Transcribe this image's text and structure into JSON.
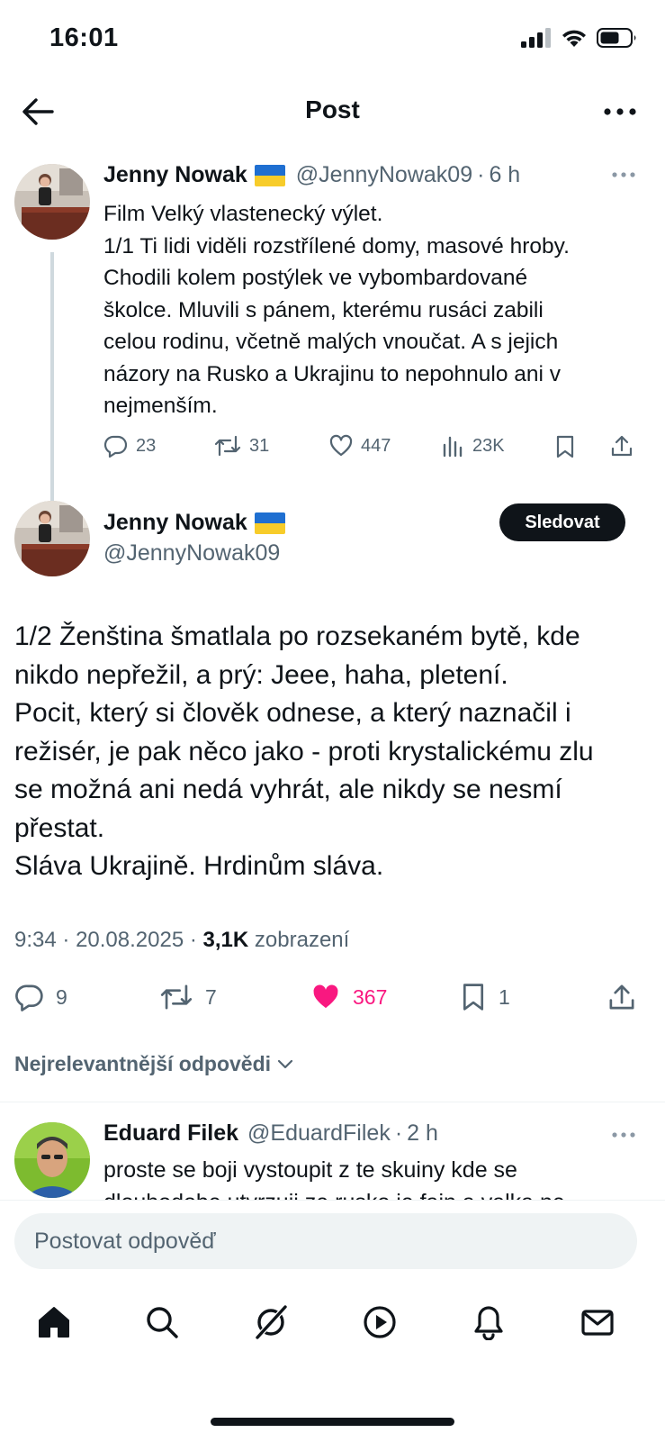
{
  "status_bar": {
    "time": "16:01"
  },
  "header": {
    "title": "Post"
  },
  "parent_tweet": {
    "name": "Jenny Nowak",
    "handle": "@JennyNowak09",
    "separator": "·",
    "time": "6 h",
    "lines": [
      "Film Velký vlastenecký výlet.",
      "1/1 Ti lidi viděli rozstřílené domy, masové hroby.",
      "Chodili kolem postýlek ve vybombardované",
      "školce. Mluvili s pánem, kterému rusáci zabili",
      "celou rodinu, včetně malých vnoučat. A s jejich",
      "názory na Rusko a Ukrajinu to nepohnulo ani v",
      "nejmenším."
    ],
    "stats": {
      "replies": "23",
      "reposts": "31",
      "likes": "447",
      "views": "23K"
    }
  },
  "main_tweet": {
    "name": "Jenny Nowak",
    "handle": "@JennyNowak09",
    "follow_label": "Sledovat",
    "lines": [
      "1/2 Ženština šmatlala po rozsekaném bytě, kde",
      "nikdo nepřežil, a prý: Jeee, haha, pletení.",
      "Pocit, který si člověk odnese, a který naznačil i",
      "režisér, je pak něco jako - proti krystalickému zlu",
      "se možná ani nedá vyhrát, ale nikdy se nesmí",
      "přestat.",
      "Sláva Ukrajině. Hrdinům sláva."
    ],
    "meta": {
      "time": "9:34",
      "sep": "·",
      "date": "20.08.2025",
      "views": "3,1K",
      "views_label": "zobrazení"
    },
    "stats": {
      "replies": "9",
      "reposts": "7",
      "likes": "367",
      "bookmarks": "1"
    },
    "like_color": "#f91880"
  },
  "replies_sort": {
    "label": "Nejrelevantnější odpovědi"
  },
  "reply": {
    "name": "Eduard Filek",
    "handle": "@EduardFilek",
    "separator": "·",
    "time": "2 h",
    "line1": "proste se boji vystoupit z te skuiny kde se",
    "line2": "dlouhodobe utvrzuji ze rusko je fajn a valka ne"
  },
  "composer": {
    "placeholder": "Postovat odpověď"
  },
  "nav": {
    "items": [
      "home-icon",
      "search-icon",
      "grok-icon",
      "video-icon",
      "notifications-icon",
      "messages-icon"
    ]
  }
}
